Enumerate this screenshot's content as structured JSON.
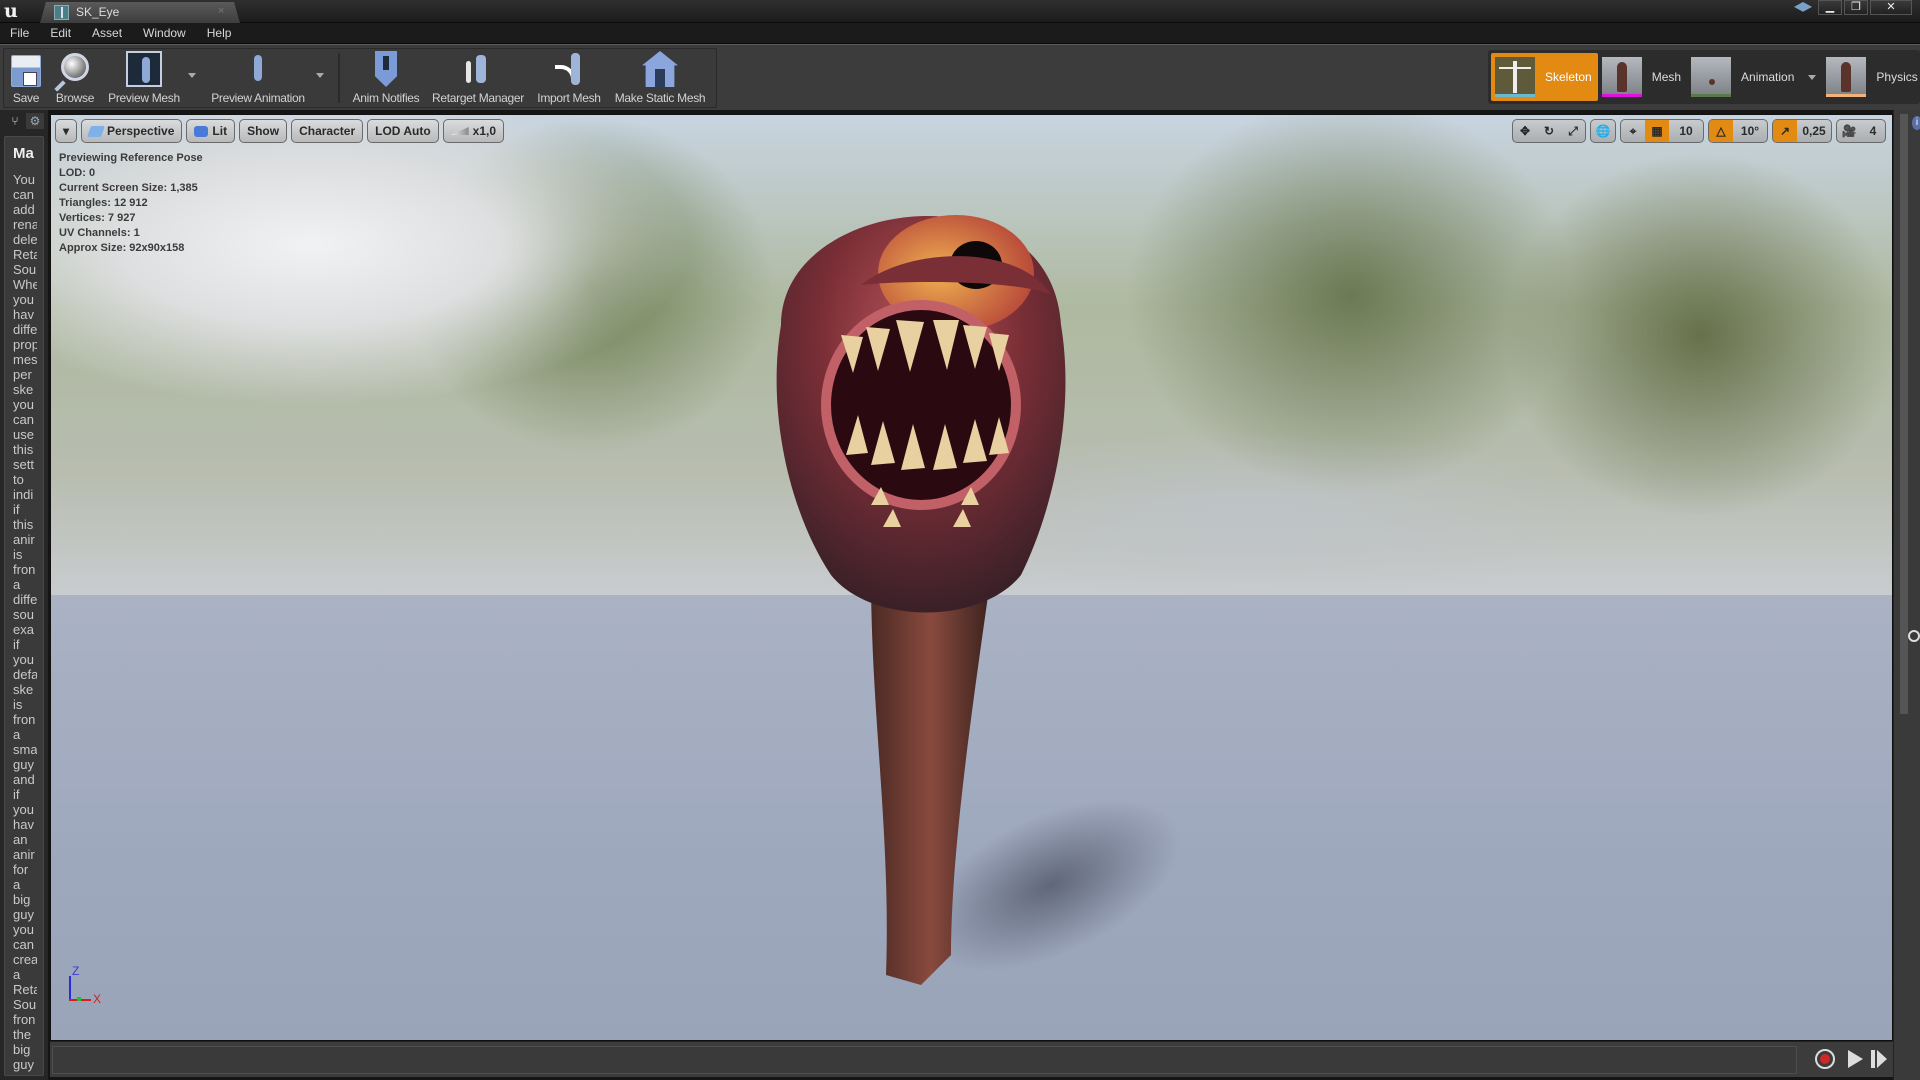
{
  "titlebar": {
    "tab_title": "SK_Eye",
    "close_tab_glyph": "×",
    "window_controls": {
      "minimize": "▁",
      "restore": "❐",
      "close": "✕"
    },
    "icons": [
      "unreal-logo-icon",
      "skeleton-asset-icon",
      "learn-icon"
    ]
  },
  "menubar": {
    "items": [
      "File",
      "Edit",
      "Asset",
      "Window",
      "Help"
    ]
  },
  "toolbar": {
    "buttons": [
      {
        "label": "Save",
        "icon": "save-icon"
      },
      {
        "label": "Browse",
        "icon": "browse-icon"
      },
      {
        "label": "Preview Mesh",
        "icon": "preview-mesh-icon",
        "has_dropdown": true
      },
      {
        "label": "Preview Animation",
        "icon": "preview-animation-icon",
        "has_dropdown": true
      },
      {
        "label": "Anim Notifies",
        "icon": "anim-notifies-icon"
      },
      {
        "label": "Retarget Manager",
        "icon": "retarget-manager-icon"
      },
      {
        "label": "Import Mesh",
        "icon": "import-mesh-icon"
      },
      {
        "label": "Make Static Mesh",
        "icon": "make-static-mesh-icon"
      }
    ],
    "modes": [
      {
        "label": "Skeleton",
        "active": true,
        "accent": "#6ab9d0"
      },
      {
        "label": "Mesh",
        "active": false,
        "accent": "#e010e0"
      },
      {
        "label": "Animation",
        "active": false,
        "accent": "#5a7a4a",
        "has_dropdown": true
      },
      {
        "label": "Physics",
        "active": false,
        "accent": "#f2b27a"
      }
    ],
    "active_color": "#e38a12"
  },
  "left_panel": {
    "title": "Ma",
    "text_words": [
      "You",
      "can",
      "add",
      "rena",
      "dele",
      "Reta",
      "Sou",
      "Whe",
      "you",
      "hav",
      "diffe",
      "prop",
      "mes",
      "per",
      "ske",
      "you",
      "can",
      "use",
      "this",
      "sett",
      "to",
      "indi",
      "if",
      "this",
      "anir",
      "is",
      "fron",
      "a",
      "diffe",
      "sou",
      "exa",
      "if",
      "you",
      "defa",
      "ske",
      "is",
      "fron",
      "a",
      "sma",
      "guy",
      "and",
      "if",
      "you",
      "hav",
      "an",
      "anir",
      "for",
      "a",
      "big",
      "guy",
      "you",
      "can",
      "crea",
      "a",
      "Reta",
      "Sou",
      "fron",
      "the",
      "big",
      "guy"
    ]
  },
  "viewport": {
    "toolbar_left": {
      "options_glyph": "▾",
      "perspective": "Perspective",
      "lit": "Lit",
      "show": "Show",
      "character": "Character",
      "lod": "LOD Auto",
      "speed": "x1,0"
    },
    "toolbar_right": {
      "grid_snap": "10",
      "rotation_snap": "10°",
      "scale_snap": "0,25",
      "camera_speed": "4"
    },
    "info": {
      "line1": "Previewing Reference Pose",
      "lod": "LOD: 0",
      "screen_size": "Current Screen Size: 1,385",
      "triangles": "Triangles: 12 912",
      "vertices": "Vertices: 7 927",
      "uv_channels": "UV Channels: 1",
      "approx_size": "Approx Size: 92x90x158"
    },
    "axis": {
      "z": "Z",
      "x": "X"
    }
  },
  "timeline": {
    "record": "record",
    "play": "play",
    "step": "step-forward"
  }
}
